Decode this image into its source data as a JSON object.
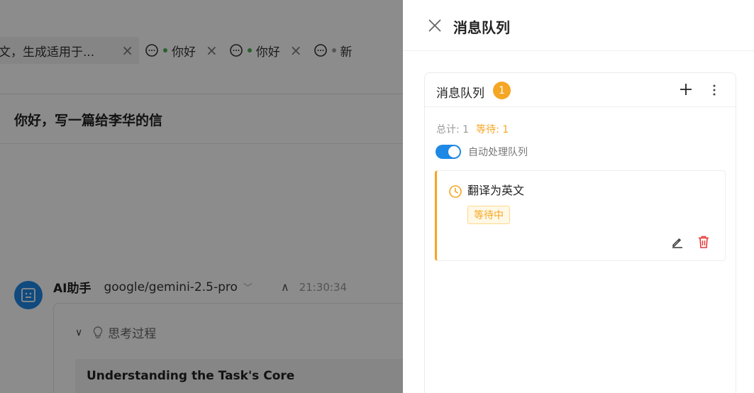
{
  "background": {
    "tabs": [
      {
        "label": "文，生成适用于..."
      },
      {
        "label": "你好"
      },
      {
        "label": "你好"
      },
      {
        "label": "新"
      }
    ],
    "conversation_title": "你好，写一篇给李华的信",
    "message": {
      "sender": "AI助手",
      "model": "google/gemini-2.5-pro",
      "time": "21:30:34",
      "thinking_label": "思考过程",
      "thinking_title": "Understanding the Task's Core"
    }
  },
  "drawer": {
    "title": "消息队列",
    "card": {
      "title": "消息队列",
      "count": "1",
      "stats": {
        "total": "总计: 1",
        "waiting": "等待: 1"
      },
      "auto_process_label": "自动处理队列",
      "auto_process_on": true,
      "items": [
        {
          "text": "翻译为英文",
          "status": "等待中"
        }
      ]
    }
  },
  "colors": {
    "accent_blue": "#1e88e5",
    "warning_orange": "#f5a623",
    "danger_red": "#e53935"
  }
}
